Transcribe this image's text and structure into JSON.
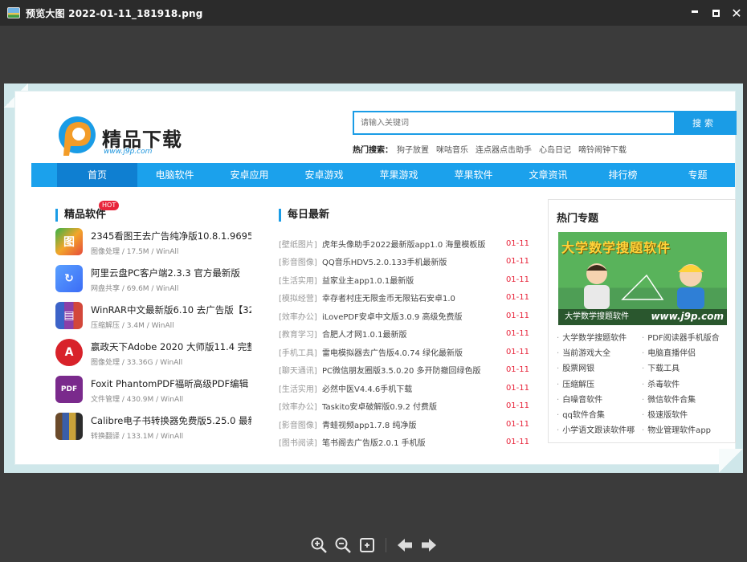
{
  "viewer": {
    "title": "预览大图 2022-01-11_181918.png",
    "window_buttons": [
      "minimize",
      "maximize",
      "close"
    ],
    "tools": [
      "zoom-in",
      "zoom-out",
      "fit",
      "previous",
      "next"
    ]
  },
  "site": {
    "logo": {
      "name": "精品下载",
      "url": "www.j9p.com"
    },
    "search": {
      "placeholder": "请输入关键词",
      "button": "搜索"
    },
    "hot_search": {
      "label": "热门搜索：",
      "words": [
        "狗子放置",
        "咪咕音乐",
        "连点器点击助手",
        "心岛日记",
        "嘀铃闹钟下载"
      ]
    },
    "nav": [
      "首页",
      "电脑软件",
      "安卓应用",
      "安卓游戏",
      "苹果游戏",
      "苹果软件",
      "文章资讯",
      "排行榜",
      "专题"
    ],
    "software": {
      "title": "精品软件",
      "badge": "HOT",
      "items": [
        {
          "name": "2345看图王去广告纯净版10.8.1.9695",
          "meta": "图像处理 / 17.5M / WinAll",
          "icon_color": "#f2a62a",
          "icon": "image-viewer-icon"
        },
        {
          "name": "阿里云盘PC客户端2.3.3 官方最新版",
          "meta": "网盘共享 / 69.6M / WinAll",
          "icon_color": "#3b82f6",
          "icon": "cloud-drive-icon"
        },
        {
          "name": "WinRAR中文最新版6.10 去广告版【32",
          "meta": "压缩解压 / 3.4M / WinAll",
          "icon_color": "#8b3fa8",
          "icon": "archive-icon"
        },
        {
          "name": "嬴政天下Adobe 2020 大师版11.4 完整",
          "meta": "图像处理 / 33.36G / WinAll",
          "icon_color": "#d8222a",
          "icon": "adobe-icon"
        },
        {
          "name": "Foxit PhantomPDF福昕高级PDF编辑",
          "meta": "文件管理 / 430.9M / WinAll",
          "icon_color": "#7a2a8c",
          "icon": "pdf-icon"
        },
        {
          "name": "Calibre电子书转换器免费版5.25.0 最新",
          "meta": "转换翻译 / 133.1M / WinAll",
          "icon_color": "#6b4a2a",
          "icon": "books-icon"
        }
      ]
    },
    "news": {
      "title": "每日最新",
      "items": [
        {
          "cat": "[壁纸图片]",
          "title": "虎年头像助手2022最新版app1.0 海量模板版",
          "date": "01-11"
        },
        {
          "cat": "[影音图像]",
          "title": "QQ音乐HDV5.2.0.133手机最新版",
          "date": "01-11"
        },
        {
          "cat": "[生活实用]",
          "title": "益家业主app1.0.1最新版",
          "date": "01-11"
        },
        {
          "cat": "[模拟经营]",
          "title": "幸存者村庄无限金币无限钻石安卓1.0",
          "date": "01-11"
        },
        {
          "cat": "[效率办公]",
          "title": "iLovePDF安卓中文版3.0.9 高级免费版",
          "date": "01-11"
        },
        {
          "cat": "[教育学习]",
          "title": "合肥人才网1.0.1最新版",
          "date": "01-11"
        },
        {
          "cat": "[手机工具]",
          "title": "雷电模拟器去广告版4.0.74 绿化最新版",
          "date": "01-11"
        },
        {
          "cat": "[聊天通讯]",
          "title": "PC微信朋友圈版3.5.0.20 多开防撤回绿色版",
          "date": "01-11"
        },
        {
          "cat": "[生活实用]",
          "title": "必然中医V4.4.6手机下载",
          "date": "01-11"
        },
        {
          "cat": "[效率办公]",
          "title": "Taskito安卓破解版0.9.2 付费版",
          "date": "01-11"
        },
        {
          "cat": "[影音图像]",
          "title": "青蛙视频app1.7.8 纯净版",
          "date": "01-11"
        },
        {
          "cat": "[图书阅读]",
          "title": "笔书阁去广告版2.0.1 手机版",
          "date": "01-11"
        }
      ]
    },
    "topics": {
      "title": "热门专题",
      "banner": {
        "title": "大学数学搜题软件",
        "caption": "大学数学搜题软件",
        "url": "www.j9p.com"
      },
      "links": [
        "大学数学搜题软件",
        "PDF阅读器手机版合",
        "当前游戏大全",
        "电脑直播伴侣",
        "股票网银",
        "下载工具",
        "压缩解压",
        "杀毒软件",
        "白噪音软件",
        "微信软件合集",
        "qq软件合集",
        "极速版软件",
        "小学语文跟读软件哪",
        "物业管理软件app"
      ]
    }
  }
}
